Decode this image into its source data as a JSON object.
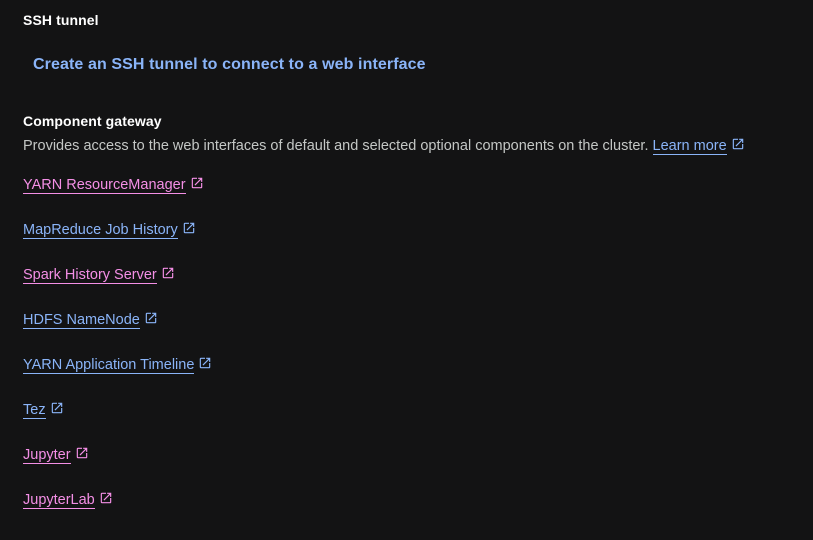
{
  "ssh": {
    "heading": "SSH tunnel",
    "button_label": "Create an SSH tunnel to connect to a web interface"
  },
  "gateway": {
    "heading": "Component gateway",
    "description": "Provides access to the web interfaces of default and selected optional components on the cluster.",
    "learn_more": "Learn more",
    "links": [
      {
        "label": "YARN ResourceManager",
        "visited": true
      },
      {
        "label": "MapReduce Job History",
        "visited": false
      },
      {
        "label": "Spark History Server",
        "visited": true
      },
      {
        "label": "HDFS NameNode",
        "visited": false
      },
      {
        "label": "YARN Application Timeline",
        "visited": false
      },
      {
        "label": "Tez",
        "visited": false
      },
      {
        "label": "Jupyter",
        "visited": true
      },
      {
        "label": "JupyterLab",
        "visited": true
      }
    ]
  },
  "colors": {
    "background": "#131314",
    "link": "#8ab4f8",
    "visited_link": "#f48fe6",
    "text": "#c4c7c5",
    "heading": "#ffffff"
  },
  "icons": {
    "external": "open-in-new-icon"
  }
}
